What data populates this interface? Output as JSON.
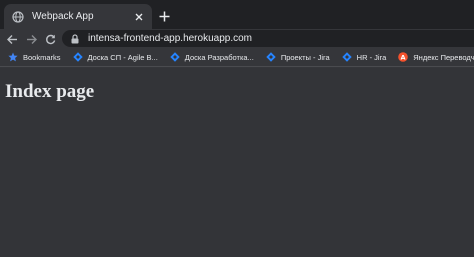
{
  "tab": {
    "title": "Webpack App"
  },
  "omnibox": {
    "url": "intensa-frontend-app.herokuapp.com"
  },
  "bookmarks": [
    {
      "label": "Bookmarks",
      "icon": "star-icon"
    },
    {
      "label": "Доска СП - Agile B...",
      "icon": "jira-icon"
    },
    {
      "label": "Доска Разработка...",
      "icon": "jira-icon"
    },
    {
      "label": "Проекты - Jira",
      "icon": "jira-icon"
    },
    {
      "label": "HR - Jira",
      "icon": "jira-icon"
    },
    {
      "label": "Яндекс Переводчи...",
      "icon": "yandex-translate-icon"
    }
  ],
  "page": {
    "heading": "Index page"
  },
  "colors": {
    "tabstrip": "#202124",
    "toolbar": "#35363a",
    "page_background": "#333438",
    "text": "#e8eaed",
    "bookmark_star": "#4285f4",
    "jira": "#2684ff"
  }
}
